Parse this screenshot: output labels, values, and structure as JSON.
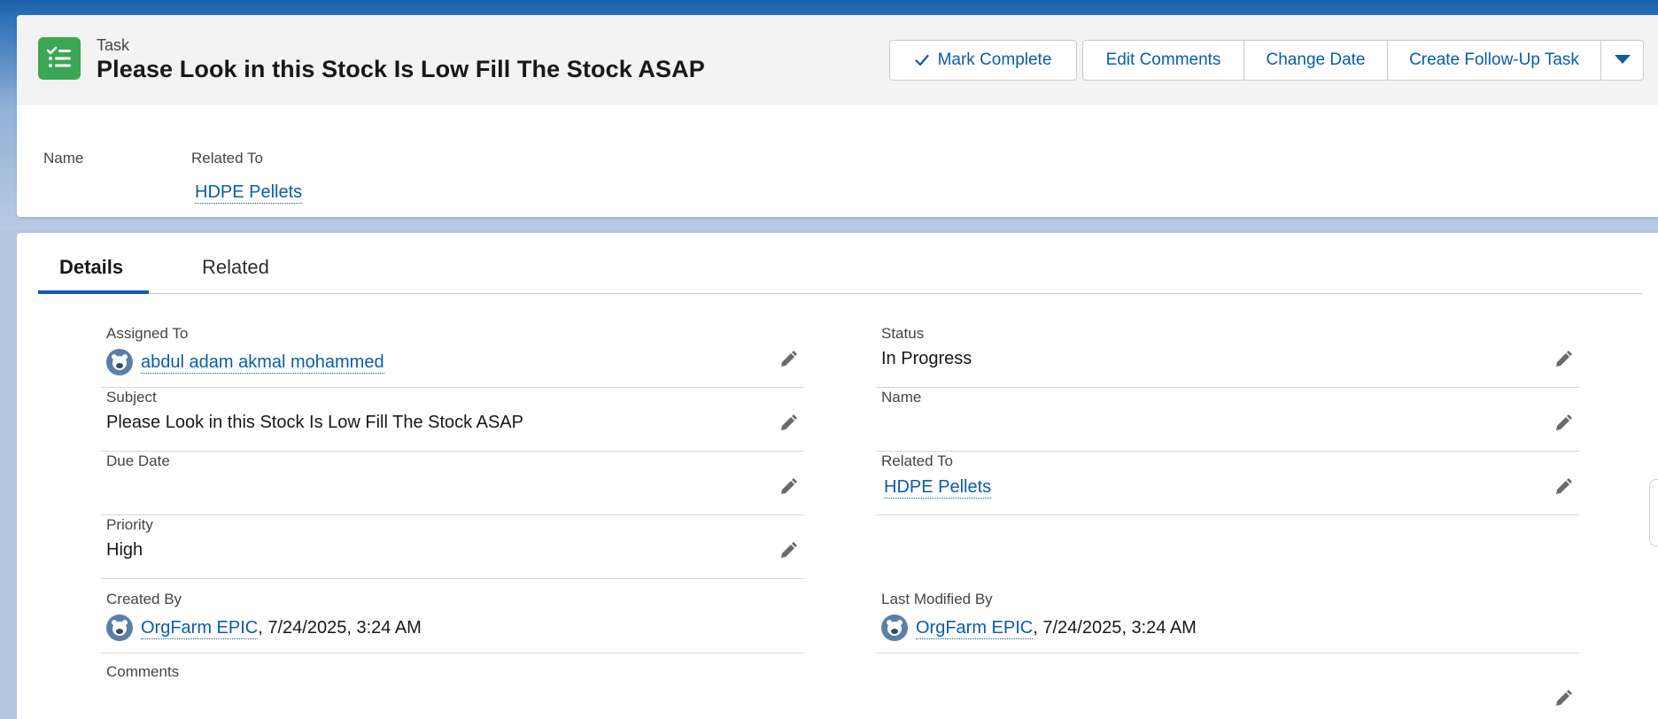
{
  "header": {
    "object_label": "Task",
    "title": "Please Look in this Stock Is Low Fill The Stock ASAP",
    "icon": "task-list-icon",
    "accent": "#3ba755"
  },
  "actions": {
    "mark_complete": "Mark Complete",
    "edit_comments": "Edit Comments",
    "change_date": "Change Date",
    "create_follow_up": "Create Follow-Up Task"
  },
  "highlights": {
    "name_label": "Name",
    "related_to_label": "Related To",
    "related_to_value": "HDPE Pellets"
  },
  "tabs": {
    "details": "Details",
    "related": "Related"
  },
  "fields": {
    "assigned_to": {
      "label": "Assigned To",
      "value": "abdul adam akmal mohammed"
    },
    "status": {
      "label": "Status",
      "value": "In Progress"
    },
    "subject": {
      "label": "Subject",
      "value": "Please Look in this Stock Is Low Fill The Stock ASAP"
    },
    "name": {
      "label": "Name",
      "value": ""
    },
    "due_date": {
      "label": "Due Date",
      "value": ""
    },
    "related_to": {
      "label": "Related To",
      "value": "HDPE Pellets"
    },
    "priority": {
      "label": "Priority",
      "value": "High"
    },
    "created_by": {
      "label": "Created By",
      "user": "OrgFarm EPIC",
      "date": ", 7/24/2025, 3:24 AM"
    },
    "last_modified_by": {
      "label": "Last Modified By",
      "user": "OrgFarm EPIC",
      "date": ", 7/24/2025, 3:24 AM"
    },
    "comments": {
      "label": "Comments",
      "value": ""
    }
  },
  "colors": {
    "link": "#0b5cab",
    "brand_banner": "#1b5fa8"
  }
}
